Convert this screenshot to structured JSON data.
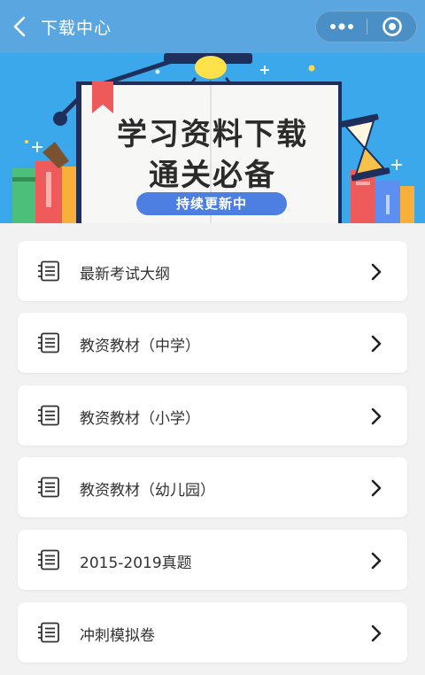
{
  "navbar": {
    "title": "下载中心",
    "back_icon": "chevron-left-icon",
    "more_icon": "more-dots-icon",
    "close_icon": "target-close-icon",
    "bg_color": "#5aa6e0"
  },
  "banner": {
    "line1": "学习资料下载",
    "line2": "通关必备",
    "pill": "持续更新中"
  },
  "items": [
    {
      "label": "最新考试大纲",
      "icon": "list-icon"
    },
    {
      "label": "教资教材（中学）",
      "icon": "list-icon"
    },
    {
      "label": "教资教材（小学）",
      "icon": "list-icon"
    },
    {
      "label": "教资教材（幼儿园）",
      "icon": "list-icon"
    },
    {
      "label": "2015-2019真题",
      "icon": "list-icon"
    },
    {
      "label": "冲刺模拟卷",
      "icon": "list-icon"
    }
  ]
}
